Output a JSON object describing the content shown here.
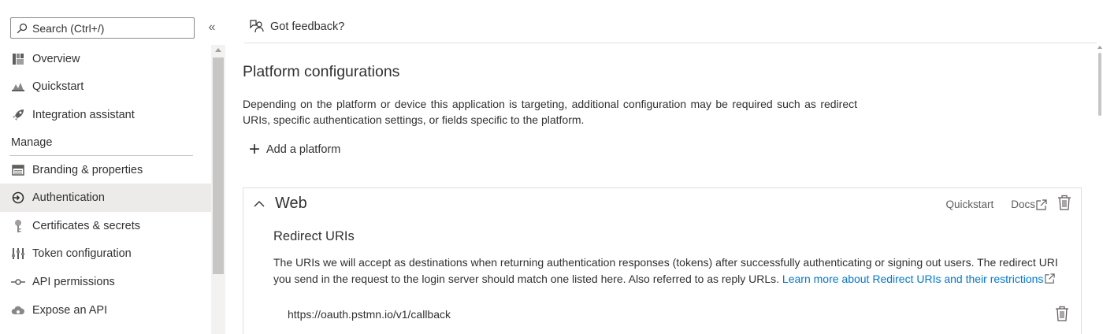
{
  "sidebar": {
    "search_placeholder": "Search (Ctrl+/)",
    "collapse_glyph": "«",
    "items": [
      {
        "label": "Overview",
        "icon": "overview-icon"
      },
      {
        "label": "Quickstart",
        "icon": "quickstart-icon"
      },
      {
        "label": "Integration assistant",
        "icon": "rocket-icon"
      }
    ],
    "section_label": "Manage",
    "manage_items": [
      {
        "label": "Branding & properties",
        "icon": "branding-icon"
      },
      {
        "label": "Authentication",
        "icon": "authentication-icon",
        "active": true
      },
      {
        "label": "Certificates & secrets",
        "icon": "key-icon"
      },
      {
        "label": "Token configuration",
        "icon": "token-icon"
      },
      {
        "label": "API permissions",
        "icon": "api-permissions-icon"
      },
      {
        "label": "Expose an API",
        "icon": "cloud-icon"
      }
    ]
  },
  "header": {
    "feedback_label": "Got feedback?"
  },
  "main": {
    "title": "Platform configurations",
    "description": "Depending on the platform or device this application is targeting, additional configuration may be required such as redirect URIs, specific authentication settings, or fields specific to the platform.",
    "add_platform_label": "Add a platform"
  },
  "web_card": {
    "name": "Web",
    "quickstart_label": "Quickstart",
    "docs_label": "Docs",
    "section_title": "Redirect URIs",
    "body_text": "The URIs we will accept as destinations when returning authentication responses (tokens) after successfully authenticating or signing out users. The redirect URI you send in the request to the login server should match one listed here. Also referred to as reply URLs. ",
    "learn_more_link": "Learn more about Redirect URIs and their restrictions",
    "redirect_uris": [
      "https://oauth.pstmn.io/v1/callback"
    ]
  },
  "colors": {
    "text": "#323130",
    "link": "#0078d4",
    "active_bg": "#edebe9",
    "border": "#e1dfdd"
  }
}
